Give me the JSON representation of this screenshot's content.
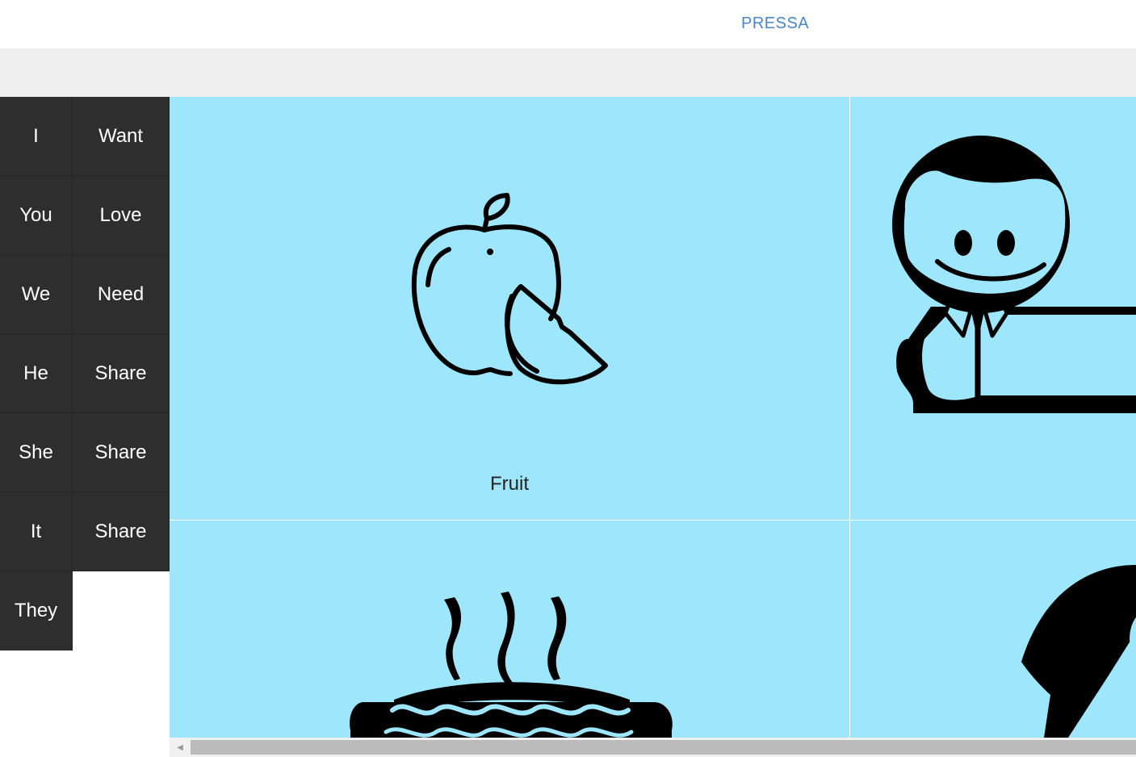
{
  "header": {
    "brand": "PRESSA"
  },
  "word_panel": {
    "pronouns": [
      "I",
      "You",
      "We",
      "He",
      "She",
      "It",
      "They"
    ],
    "verbs": [
      "Want",
      "Love",
      "Need",
      "Share",
      "Share",
      "Share"
    ]
  },
  "tiles": [
    {
      "label": "Fruit",
      "icon": "apple-slice-icon"
    },
    {
      "label": "",
      "icon": "man-in-suit-icon"
    },
    {
      "label": "",
      "icon": "hot-dog-icon"
    },
    {
      "label": "",
      "icon": "woman-icon"
    }
  ],
  "colors": {
    "tile_bg": "#9de6fc",
    "panel_bg": "#2e2e2e",
    "brand": "#4a86c8"
  }
}
